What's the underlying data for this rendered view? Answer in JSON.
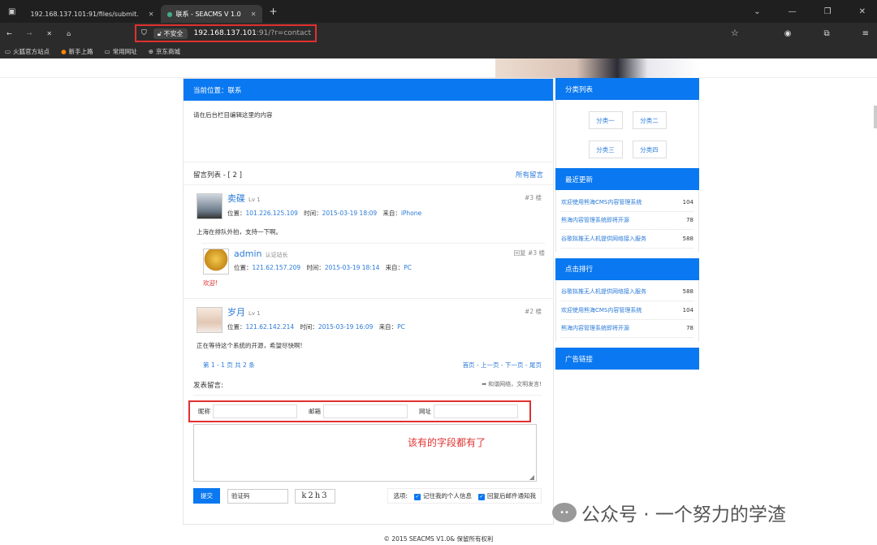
{
  "browser": {
    "tabs": [
      {
        "title": "192.168.137.101:91/files/submit.",
        "close": "✕"
      },
      {
        "title": "联系 - SEACMS V 1.0",
        "close": "✕"
      }
    ],
    "new_tab": "+",
    "url_security": "不安全",
    "url_host": "192.168.137.101",
    "url_path": ":91/?r=contact",
    "bookmarks": [
      "火狐官方站点",
      "新手上路",
      "常用网址",
      "京东商城"
    ]
  },
  "main": {
    "breadcrumb": "当前位置：联系",
    "content": "请在后台栏目编辑这里的内容",
    "msg_list_title": "留言列表 - [ 2 ]",
    "all_msgs": "所有留言",
    "messages": [
      {
        "name": "卖碟",
        "lv": "Lv 1",
        "floor": "#3 楼",
        "pos_label": "位置：",
        "ip": "101.226.125.109",
        "time_label": "时间：",
        "time": "2015-03-19 18:09",
        "from_label": "来自：",
        "from": "iPhone",
        "text": "上海在排队外拍，支持一下啊。",
        "reply": {
          "name": "admin",
          "role": "认证站长",
          "floor": "回复 #3 楼",
          "pos_label": "位置：",
          "ip": "121.62.157.209",
          "time_label": "时间：",
          "time": "2015-03-19 18:14",
          "from_label": "来自：",
          "from": "PC",
          "text": "欢迎!"
        }
      },
      {
        "name": "岁月",
        "lv": "Lv 1",
        "floor": "#2 楼",
        "pos_label": "位置：",
        "ip": "121.62.142.214",
        "time_label": "时间：",
        "time": "2015-03-19 16:09",
        "from_label": "来自：",
        "from": "PC",
        "text": "正在等待这个系统的开源，希望尽快啊!"
      }
    ],
    "pager_info": "第 1 - 1 页 共 2 条",
    "pager_links": "首页 - 上一页 - 下一页 - 尾页",
    "post_title": "发表留言:",
    "post_hint": "➡ 和谐网络，文明发言!",
    "fields": [
      "昵称",
      "邮箱",
      "网址"
    ],
    "annotation": "该有的字段都有了",
    "submit": "提交",
    "captcha_label": "验证码",
    "captcha_text": "k2h3",
    "options_label": "选项:",
    "opt1": "记住我的个人信息",
    "opt2": "回复后邮件通知我"
  },
  "sidebar": {
    "cat_title": "分类列表",
    "categories": [
      "分类一",
      "分类二",
      "分类三",
      "分类四"
    ],
    "recent_title": "最近更新",
    "recent": [
      {
        "title": "欢迎使用熊海CMS内容管理系统",
        "count": "104"
      },
      {
        "title": "熊海内容管理系统即将开源",
        "count": "78"
      },
      {
        "title": "谷歌拟推无人机提供网络接入服务",
        "count": "588"
      }
    ],
    "rank_title": "点击排行",
    "rank": [
      {
        "title": "谷歌拟推无人机提供网络接入服务",
        "count": "588"
      },
      {
        "title": "欢迎使用熊海CMS内容管理系统",
        "count": "104"
      },
      {
        "title": "熊海内容管理系统即将开源",
        "count": "78"
      }
    ],
    "ad_title": "广告链接"
  },
  "footer": "© 2015 SEACMS V1.0& 保留所有权利",
  "watermark": "公众号 · 一个努力的学渣"
}
